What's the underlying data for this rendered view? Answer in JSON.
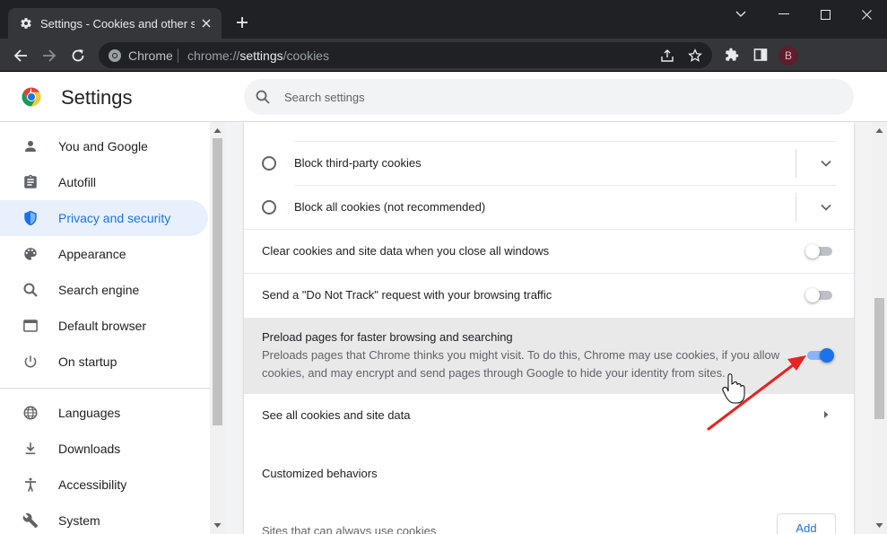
{
  "browser": {
    "tab_title": "Settings - Cookies and other site data",
    "omnibox": {
      "chip": "Chrome",
      "url_prefix": "chrome://",
      "url_host": "settings",
      "url_path": "/cookies"
    },
    "profile_initial": "B"
  },
  "header": {
    "title": "Settings",
    "search_placeholder": "Search settings"
  },
  "sidebar": {
    "items": [
      {
        "label": "You and Google",
        "icon": "person-icon",
        "active": false
      },
      {
        "label": "Autofill",
        "icon": "clipboard-icon",
        "active": false
      },
      {
        "label": "Privacy and security",
        "icon": "shield-icon",
        "active": true
      },
      {
        "label": "Appearance",
        "icon": "palette-icon",
        "active": false
      },
      {
        "label": "Search engine",
        "icon": "search-icon",
        "active": false
      },
      {
        "label": "Default browser",
        "icon": "browser-window-icon",
        "active": false
      },
      {
        "label": "On startup",
        "icon": "power-icon",
        "active": false
      },
      {
        "label": "Languages",
        "icon": "globe-icon",
        "active": false
      },
      {
        "label": "Downloads",
        "icon": "download-icon",
        "active": false
      },
      {
        "label": "Accessibility",
        "icon": "accessibility-icon",
        "active": false
      },
      {
        "label": "System",
        "icon": "wrench-icon",
        "active": false
      }
    ]
  },
  "content": {
    "radio_block_third_party": "Block third-party cookies",
    "radio_block_all": "Block all cookies (not recommended)",
    "clear_on_close": {
      "label": "Clear cookies and site data when you close all windows",
      "enabled": false
    },
    "do_not_track": {
      "label": "Send a \"Do Not Track\" request with your browsing traffic",
      "enabled": false
    },
    "preload": {
      "label": "Preload pages for faster browsing and searching",
      "description": "Preloads pages that Chrome thinks you might visit. To do this, Chrome may use cookies, if you allow cookies, and may encrypt and send pages through Google to hide your identity from sites.",
      "enabled": true
    },
    "see_all": "See all cookies and site data",
    "customized_behaviors": "Customized behaviors",
    "sites_always_use": "Sites that can always use cookies",
    "add_button": "Add"
  },
  "colors": {
    "accent": "#1a73e8",
    "annotation_arrow": "#e52521"
  }
}
